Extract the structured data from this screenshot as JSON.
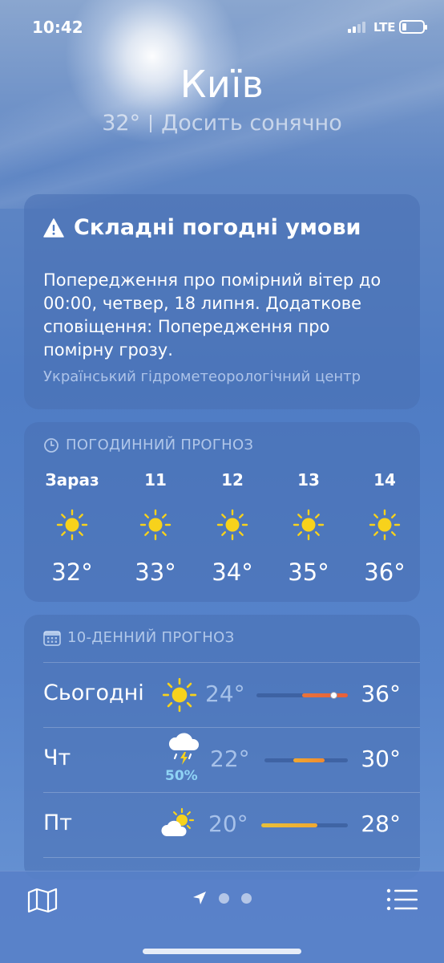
{
  "status_bar": {
    "time": "10:42",
    "network": "LTE"
  },
  "location": {
    "city": "Київ",
    "current_temp": "32°",
    "condition": "Досить сонячно"
  },
  "alert": {
    "title": "Складні погодні умови",
    "body": "Попередження про помірний вітер до 00:00, четвер, 18 липня. Додаткове сповіщення: Попередження про помірну грозу.",
    "source": "Український гідрометеорологічний центр"
  },
  "hourly": {
    "title": "ПОГОДИННИЙ ПРОГНОЗ",
    "hours": [
      {
        "label": "Зараз",
        "icon": "sun-icon",
        "temp": "32°"
      },
      {
        "label": "11",
        "icon": "sun-icon",
        "temp": "33°"
      },
      {
        "label": "12",
        "icon": "sun-icon",
        "temp": "34°"
      },
      {
        "label": "13",
        "icon": "sun-icon",
        "temp": "35°"
      },
      {
        "label": "14",
        "icon": "sun-icon",
        "temp": "36°"
      }
    ]
  },
  "daily": {
    "title": "10-ДЕННИЙ ПРОГНОЗ",
    "days": [
      {
        "day": "Сьогодні",
        "icon": "sun-icon",
        "precip": "",
        "low": "24°",
        "high": "36°",
        "range_start": 0.5,
        "range_end": 1.0,
        "current_marker": 0.85,
        "gradient": [
          "#e8733a",
          "#e8603a"
        ]
      },
      {
        "day": "Чт",
        "icon": "thunderstorm-icon",
        "precip": "50%",
        "low": "22°",
        "high": "30°",
        "range_start": 0.35,
        "range_end": 0.72,
        "current_marker": null,
        "gradient": [
          "#f0a830",
          "#f08a30"
        ]
      },
      {
        "day": "Пт",
        "icon": "partly-cloudy-icon",
        "precip": "",
        "low": "20°",
        "high": "28°",
        "range_start": 0.0,
        "range_end": 0.65,
        "current_marker": null,
        "gradient": [
          "#e8c03a",
          "#f0a830"
        ]
      }
    ]
  },
  "colors": {
    "sun": "#f7d21c",
    "precip": "#8fd3f5"
  }
}
